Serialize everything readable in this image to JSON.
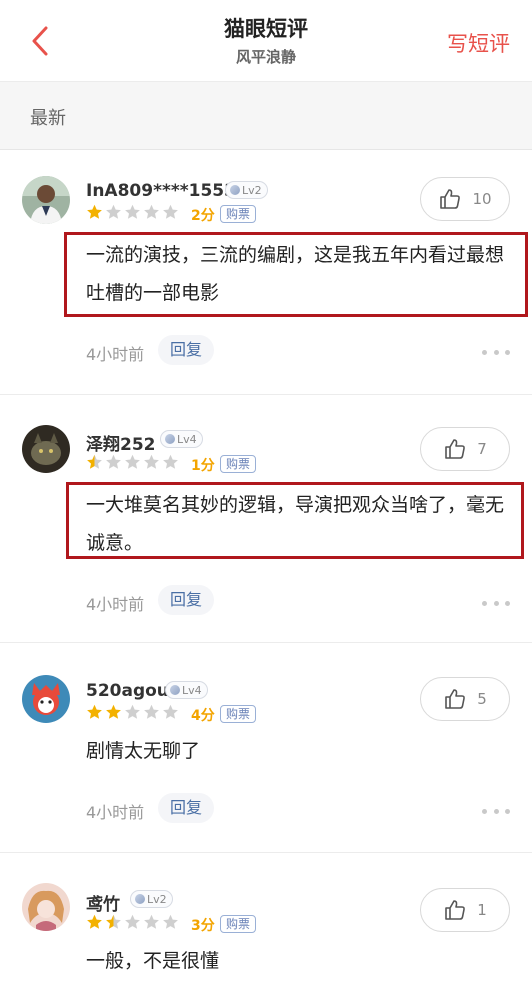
{
  "header": {
    "title": "猫眼短评",
    "subtitle": "风平浪静",
    "write_label": "写短评"
  },
  "sort": {
    "label": "最新"
  },
  "reviews": [
    {
      "username": "InA809****1553",
      "level": "Lv2",
      "score": "2分",
      "stars": 1.0,
      "tag": "购票",
      "likes": "10",
      "content": "一流的演技，三流的编剧，这是我五年内看过最想吐槽的一部电影",
      "time": "4小时前",
      "reply": "回复"
    },
    {
      "username": "泽翔252",
      "level": "Lv4",
      "score": "1分",
      "stars": 0.5,
      "tag": "购票",
      "likes": "7",
      "content": "一大堆莫名其妙的逻辑，导演把观众当啥了，毫无诚意。",
      "time": "4小时前",
      "reply": "回复"
    },
    {
      "username": "520agou",
      "level": "Lv4",
      "score": "4分",
      "stars": 2.0,
      "tag": "购票",
      "likes": "5",
      "content": "剧情太无聊了",
      "time": "4小时前",
      "reply": "回复"
    },
    {
      "username": "鸢竹",
      "level": "Lv2",
      "score": "3分",
      "stars": 1.5,
      "tag": "购票",
      "likes": "1",
      "content": "一般，不是很懂",
      "time": "",
      "reply": ""
    }
  ],
  "colors": {
    "accent": "#e8524b",
    "star_filled": "#f3b100",
    "star_empty": "#cfcfcf",
    "highlight": "#b0171c"
  }
}
